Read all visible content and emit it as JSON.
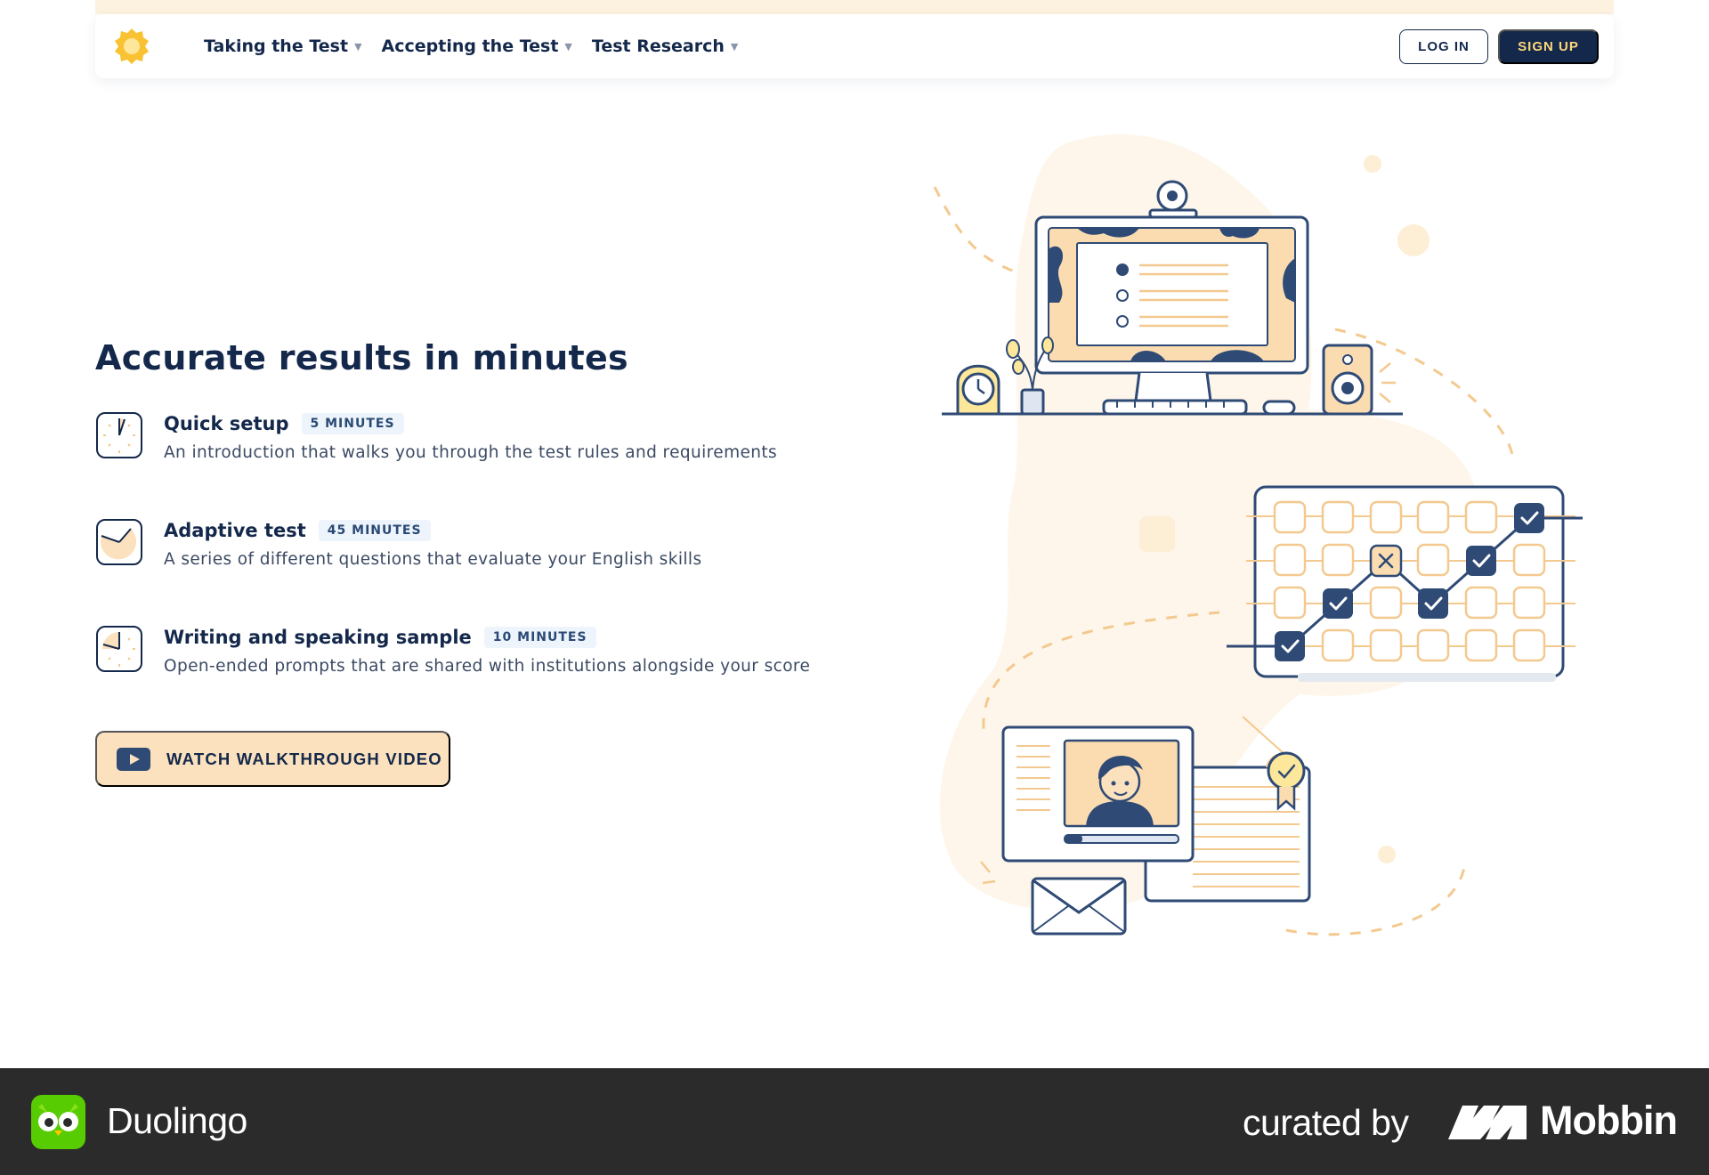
{
  "nav": {
    "items": [
      {
        "label": "Taking the Test",
        "icon": "chevron-down-icon"
      },
      {
        "label": "Accepting the Test",
        "icon": "chevron-down-icon"
      },
      {
        "label": "Test Research",
        "icon": "chevron-down-icon"
      }
    ],
    "login_label": "LOG IN",
    "signup_label": "SIGN UP"
  },
  "main": {
    "headline": "Accurate results in minutes",
    "features": [
      {
        "title": "Quick setup",
        "badge": "5 MINUTES",
        "description": "An introduction that walks you through the test rules and requirements",
        "icon": "clock-icon"
      },
      {
        "title": "Adaptive test",
        "badge": "45 MINUTES",
        "description": "A series of different questions that evaluate your English skills",
        "icon": "clock-icon"
      },
      {
        "title": "Writing and speaking sample",
        "badge": "10 MINUTES",
        "description": "Open-ended prompts that are shared with institutions alongside your score",
        "icon": "clock-icon"
      }
    ],
    "video_button": {
      "label": "WATCH WALKTHROUGH VIDEO",
      "icon": "play-video-icon"
    }
  },
  "footer": {
    "app_name": "Duolingo",
    "curated_text": "curated by",
    "brand": "Mobbin"
  },
  "colors": {
    "navy": "#14284b",
    "cream": "#fbe1bd",
    "accent_yellow": "#fdd77a",
    "footer_bg": "#2b2b2b"
  }
}
